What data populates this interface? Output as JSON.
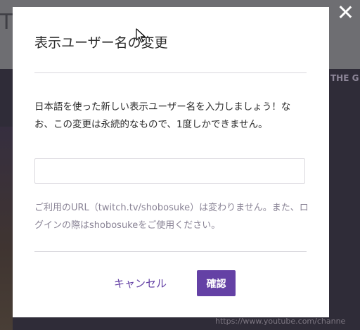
{
  "background": {
    "title": "T",
    "side_heading": "THE G",
    "url_fragment": "https://www.youtube.com/channe"
  },
  "modal": {
    "title": "表示ユーザー名の変更",
    "description": "日本語を使った新しい表示ユーザー名を入力しましょう！なお、この変更は永続的なもので、1度しかできません。",
    "input": {
      "value": "",
      "placeholder": ""
    },
    "note": "ご利用のURL（twitch.tv/shobosuke）は変わりません。また、ログインの際はshobosukeをご使用ください。",
    "cancel_label": "キャンセル",
    "confirm_label": "確認"
  },
  "colors": {
    "accent": "#6441a5",
    "overlay": "#3a3a40",
    "muted_text": "#898395"
  },
  "icons": {
    "close": "close-icon",
    "cursor": "mouse-pointer"
  }
}
